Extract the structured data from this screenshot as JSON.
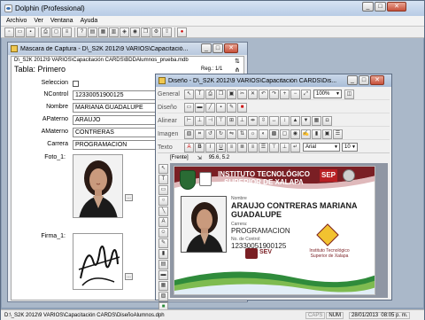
{
  "app": {
    "title": "Dolphin (Professional)"
  },
  "menu": [
    "Archivo",
    "Ver",
    "Ventana",
    "Ayuda"
  ],
  "capture_window": {
    "title": "Máscara de Captura - D\\_S2K 2012\\9 VARIOS\\Capacitació...",
    "path": "D\\_S2K 2012\\9 VARIOS\\Capacitación CARDS\\BDDAlumnos_prueba.mdb",
    "table_label": "Tabla: Primero",
    "reg_label": "Reg.: 1/1",
    "fields": {
      "seleccion": {
        "label": "Seleccion"
      },
      "ncontrol": {
        "label": "NControl",
        "value": "12330051900125"
      },
      "nombre": {
        "label": "Nombre",
        "value": "MARIANA GUADALUPE"
      },
      "apaterno": {
        "label": "APaterno",
        "value": "ARAUJO"
      },
      "amaterno": {
        "label": "AMaterno",
        "value": "CONTRERAS"
      },
      "carrera": {
        "label": "Carrera",
        "value": "PROGRAMACION"
      },
      "foto": {
        "label": "Foto_1"
      },
      "firma": {
        "label": "Firma_1"
      }
    }
  },
  "design_window": {
    "title": "Diseño - D\\_S2K 2012\\9 VARIOS\\Capacitación CARDS\\Dis...",
    "toolbars": {
      "general": "General",
      "diseno": "Diseño",
      "alinear": "Alinear",
      "imagen": "Imagen",
      "texto": "Texto"
    },
    "zoom": "100%",
    "font_name": "Arial",
    "font_size": "10",
    "frente_label": "[Frente]",
    "coords": "95.6, 5.2",
    "card": {
      "institute_line1": "INSTITUTO TECNOLÓGICO",
      "institute_line2": "SUPERIOR DE XALAPA",
      "sep_badge": "SEP",
      "nombre_label": "Nombre",
      "nombre_value": "ARAUJO CONTRERAS MARIANA GUADALUPE",
      "carrera_label": "Carrera:",
      "carrera_value": "PROGRAMACION",
      "control_label": "No. de Control:",
      "control_value": "12330051900125",
      "sev_label": "SEV",
      "itsx_label1": "Instituto Tecnológico",
      "itsx_label2": "Superior de Xalapa"
    }
  },
  "status_bar": {
    "path": "D:\\_S2K 2012\\9 VARIOS\\Capacitación CARDS\\DiseñoAlumnos.dph",
    "caps": "CAPS",
    "num": "NUM",
    "datetime": "28/01/2013  08:05 p. m."
  },
  "colors": {
    "titlebar": "#bcd0e8",
    "maroon": "#7a1f24",
    "green": "#2f8b3b"
  }
}
